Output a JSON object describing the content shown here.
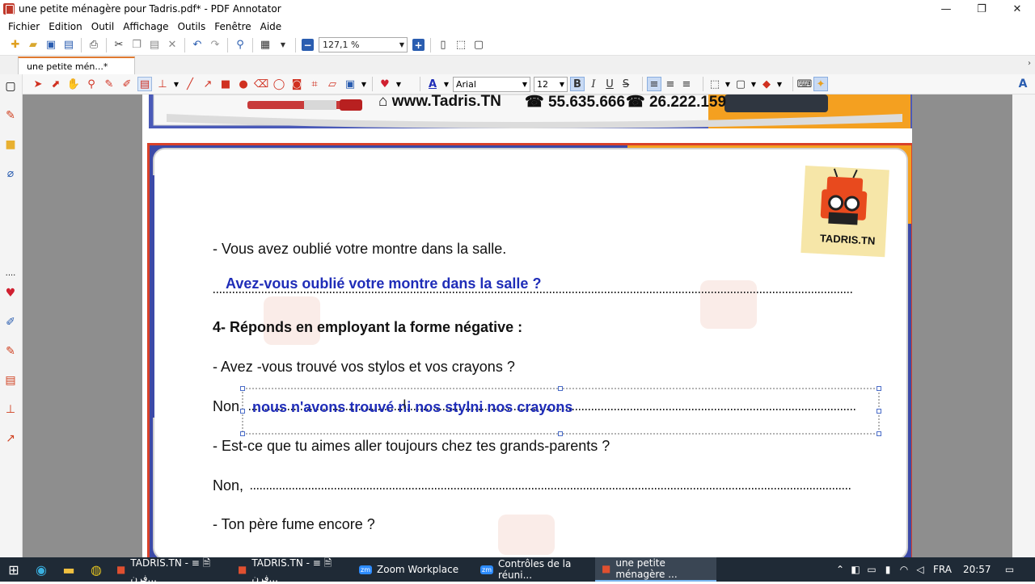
{
  "window": {
    "title": "une petite ménagère pour Tadris.pdf* - PDF Annotator",
    "controls": {
      "minimize": "—",
      "maximize": "❐",
      "close": "✕"
    }
  },
  "menu": [
    "Fichier",
    "Edition",
    "Outil",
    "Affichage",
    "Outils",
    "Fenêtre",
    "Aide"
  ],
  "toolbar": {
    "zoom_value": "127,1 %",
    "zoom_out": "−",
    "zoom_in": "+"
  },
  "tabs": {
    "active_tab": "une petite mén...*"
  },
  "annotation_toolbar": {
    "font_name": "Arial",
    "font_size": "12",
    "bold": "B",
    "italic": "I",
    "underline": "U",
    "strike": "S",
    "font_color": "#1f2db8"
  },
  "page": {
    "header_text": "www.Tadris.TN",
    "phone1": "55.635.666",
    "phone2": "26.222.159",
    "logo_text": "TADRIS.TN",
    "line1": "- Vous avez oublié votre montre dans la salle.",
    "answer1": "Avez-vous oublié votre montre dans la salle ?",
    "heading": "4- Réponds en employant la forme négative :",
    "question2": "- Avez -vous trouvé vos stylos et vos crayons ?",
    "non_label_1": "Non,",
    "answer2": "nous n'avons trouvé ni nos stylni nos crayons",
    "question3": "- Est-ce que tu aimes aller toujours chez tes grands-parents ?",
    "non_label_2": "Non,",
    "question4": "- Ton père fume encore ?"
  },
  "taskbar": {
    "items": [
      "TADRIS.TN - ≡ 🗎 فرن...",
      "TADRIS.TN - ≡ 🗎 فرن...",
      "Zoom Workplace",
      "Contrôles de la réuni...",
      "une petite ménagère ..."
    ],
    "language": "FRA",
    "time": "20:57"
  },
  "colors": {
    "accent_orange": "#e87722",
    "answer_blue": "#1f2db8",
    "taskbar_bg": "#1f2a36"
  }
}
